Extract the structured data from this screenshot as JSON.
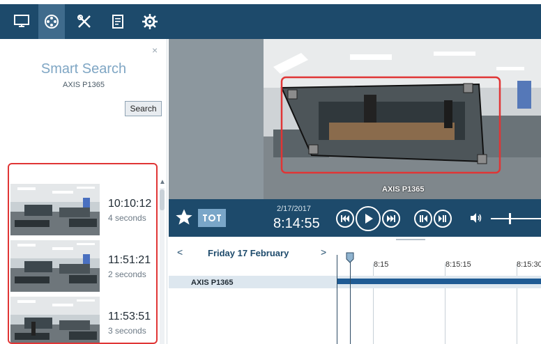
{
  "nav": {
    "items": [
      {
        "icon": "monitor-icon"
      },
      {
        "icon": "film-reel-icon",
        "active": true
      },
      {
        "icon": "tools-icon"
      },
      {
        "icon": "log-document-icon"
      },
      {
        "icon": "gear-icon"
      }
    ]
  },
  "smart_search": {
    "close": "×",
    "title": "Smart Search",
    "camera": "AXIS P1365",
    "search_label": "Search",
    "results": [
      {
        "time": "10:10:12",
        "duration": "4 seconds"
      },
      {
        "time": "11:51:21",
        "duration": "2 seconds"
      },
      {
        "time": "11:53:51",
        "duration": "3 seconds"
      }
    ]
  },
  "video": {
    "camera_label": "AXIS P1365"
  },
  "controls": {
    "date": "2/17/2017",
    "time": "8:14:55"
  },
  "timeline": {
    "prev": "<",
    "next": ">",
    "day_label": "Friday 17 February",
    "ticks": [
      "8:15",
      "8:15:15",
      "8:15:30"
    ],
    "camera_row": "AXIS P1365"
  },
  "colors": {
    "nav_bg": "#1d4a6b",
    "accent": "#7fa6c4",
    "highlight": "#e03535",
    "recording": "#1f5b94"
  }
}
